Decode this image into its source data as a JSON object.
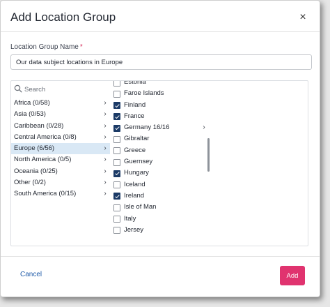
{
  "dialog": {
    "title": "Add Location Group",
    "close_symbol": "×"
  },
  "form": {
    "name_label": "Location Group Name",
    "required_marker": "*",
    "name_value": "Our data subject locations in Europe"
  },
  "search": {
    "placeholder": "Search",
    "icon": "search-icon"
  },
  "regions": [
    {
      "label": "Africa (0/58)",
      "selected": false
    },
    {
      "label": "Asia (0/53)",
      "selected": false
    },
    {
      "label": "Caribbean (0/28)",
      "selected": false
    },
    {
      "label": "Central America (0/8)",
      "selected": false
    },
    {
      "label": "Europe (6/56)",
      "selected": true
    },
    {
      "label": "North America (0/5)",
      "selected": false
    },
    {
      "label": "Oceania (0/25)",
      "selected": false
    },
    {
      "label": "Other (0/2)",
      "selected": false
    },
    {
      "label": "South America (0/15)",
      "selected": false
    }
  ],
  "countries": [
    {
      "label": "Estonia",
      "checked": false
    },
    {
      "label": "Faroe Islands",
      "checked": false
    },
    {
      "label": "Finland",
      "checked": true
    },
    {
      "label": "France",
      "checked": true
    },
    {
      "label": "Germany 16/16",
      "checked": true,
      "has_children": true
    },
    {
      "label": "Gibraltar",
      "checked": false
    },
    {
      "label": "Greece",
      "checked": false
    },
    {
      "label": "Guernsey",
      "checked": false
    },
    {
      "label": "Hungary",
      "checked": true
    },
    {
      "label": "Iceland",
      "checked": false
    },
    {
      "label": "Ireland",
      "checked": true
    },
    {
      "label": "Isle of Man",
      "checked": false
    },
    {
      "label": "Italy",
      "checked": false
    },
    {
      "label": "Jersey",
      "checked": false
    }
  ],
  "footer": {
    "cancel_label": "Cancel",
    "add_label": "Add"
  },
  "colors": {
    "primary_button": "#e0336f",
    "link": "#1e5aa8",
    "checkbox_checked": "#1b3a66",
    "selected_row": "#d9e8f5",
    "required": "#d62c5a"
  }
}
